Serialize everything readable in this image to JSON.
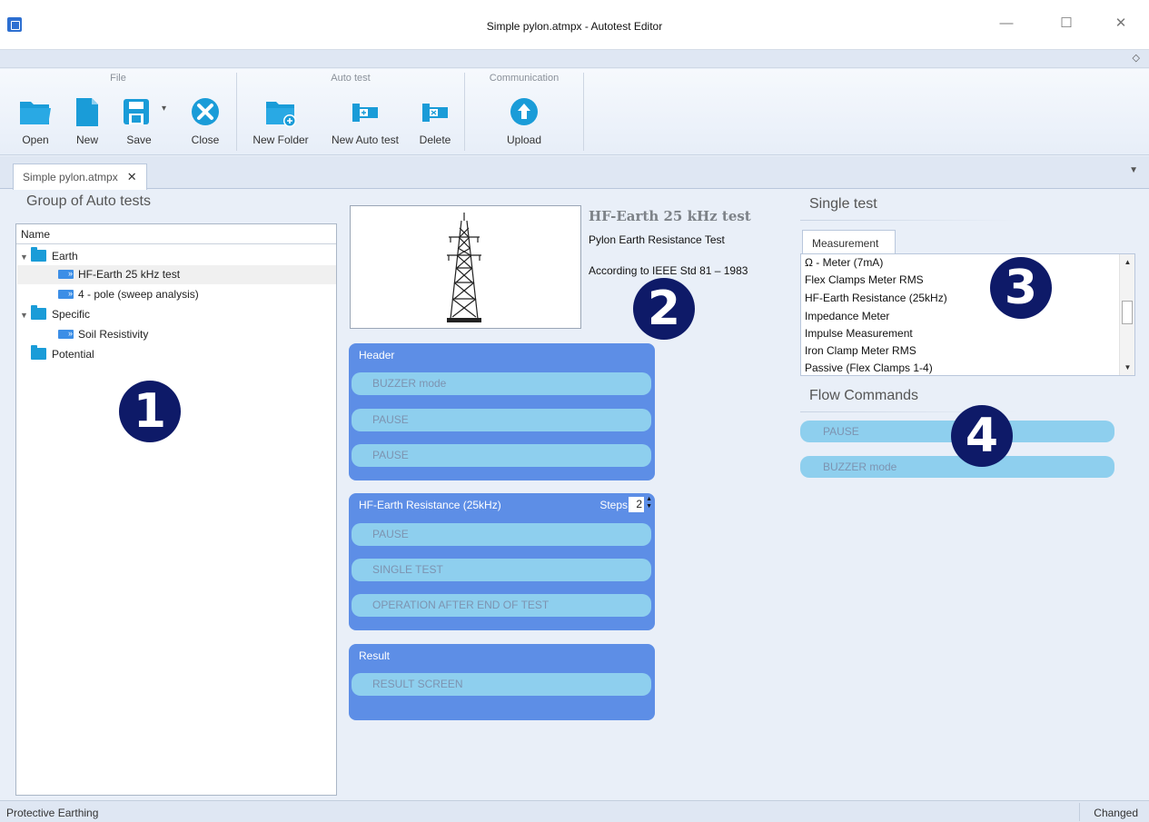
{
  "window": {
    "title": "Simple pylon.atmpx - Autotest Editor",
    "minimize": "—",
    "maximize": "☐",
    "close": "✕",
    "ribbon_collapse": "◇"
  },
  "ribbon": {
    "groups": {
      "file": "File",
      "auto_test": "Auto test",
      "communication": "Communication"
    },
    "buttons": {
      "open": "Open",
      "new": "New",
      "save": "Save",
      "save_dropdown": "▾",
      "close": "Close",
      "new_folder": "New Folder",
      "new_auto_test": "New Auto test",
      "delete": "Delete",
      "upload": "Upload"
    }
  },
  "document_tab": {
    "label": "Simple pylon.atmpx",
    "close": "✕",
    "overflow": "▼"
  },
  "left_panel": {
    "title": "Group of Auto tests",
    "column_header": "Name",
    "tree": {
      "earth": "Earth",
      "hf_earth": "HF-Earth 25 kHz test",
      "four_pole": "4 - pole (sweep analysis)",
      "specific": "Specific",
      "soil": "Soil Resistivity",
      "potential": "Potential"
    },
    "marker": "1"
  },
  "center": {
    "test_name": "HF-Earth 25 kHz test",
    "description": "Pylon Earth Resistance Test",
    "standard": "According to IEEE Std 81 – 1983",
    "marker": "2",
    "header_block": {
      "title": "Header",
      "items": [
        "BUZZER mode",
        "PAUSE",
        "PAUSE"
      ]
    },
    "test_block": {
      "title": "HF-Earth Resistance (25kHz)",
      "steps_label": "Steps",
      "steps_value": "2",
      "items": [
        "PAUSE",
        "SINGLE TEST",
        "OPERATION AFTER END OF TEST"
      ]
    },
    "result_block": {
      "title": "Result",
      "items": [
        "RESULT SCREEN"
      ]
    }
  },
  "right_panel": {
    "single_test_title": "Single test",
    "measurement_tab": "Measurement",
    "measurements": [
      "Ω - Meter (7mA)",
      "Flex Clamps Meter RMS",
      "HF-Earth Resistance (25kHz)",
      "Impedance Meter",
      "Impulse Measurement",
      "Iron Clamp Meter RMS",
      "Passive (Flex Clamps 1-4)"
    ],
    "marker_3": "3",
    "flow_commands_title": "Flow Commands",
    "flow_commands": [
      "PAUSE",
      "BUZZER mode"
    ],
    "marker_4": "4"
  },
  "status": {
    "left": "Protective Earthing",
    "right": "Changed"
  },
  "colors": {
    "block": "#5d8ee6",
    "pill": "#8ecfee",
    "marker": "#0e1a68",
    "folder": "#1a9cd8"
  }
}
